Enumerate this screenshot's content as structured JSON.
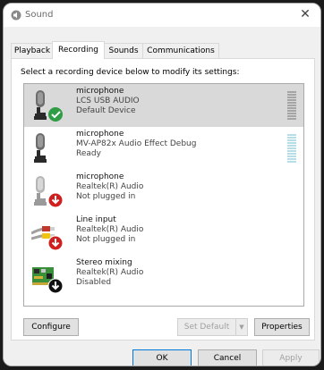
{
  "window": {
    "title": "Sound",
    "close_glyph": "✕"
  },
  "tabs": [
    {
      "label": "Playback",
      "active": false
    },
    {
      "label": "Recording",
      "active": true
    },
    {
      "label": "Sounds",
      "active": false
    },
    {
      "label": "Communications",
      "active": false
    }
  ],
  "instructions": "Select a recording device below to modify its settings:",
  "devices": [
    {
      "name": "microphone",
      "driver": "LCS USB AUDIO",
      "status": "Default Device",
      "icon": "microphone-icon",
      "badge": "green-check-badge",
      "selected": true
    },
    {
      "name": "microphone",
      "driver": "MV-AP82x Audio Effect Debug",
      "status": "Ready",
      "icon": "microphone-icon",
      "badge": "",
      "selected": false
    },
    {
      "name": "microphone",
      "driver": "Realtek(R) Audio",
      "status": "Not plugged in",
      "icon": "microphone-gray-icon",
      "badge": "red-down-arrow-badge",
      "selected": false
    },
    {
      "name": "Line input",
      "driver": "Realtek(R) Audio",
      "status": "Not plugged in",
      "icon": "line-input-cable-icon",
      "badge": "red-down-arrow-badge",
      "selected": false
    },
    {
      "name": "Stereo mixing",
      "driver": "Realtek(R) Audio",
      "status": "Disabled",
      "icon": "sound-card-icon",
      "badge": "black-down-arrow-badge",
      "selected": false
    }
  ],
  "buttons": {
    "configure": "Configure",
    "set_default": "Set Default",
    "set_default_arrow": "▼",
    "properties": "Properties",
    "ok": "OK",
    "cancel": "Cancel",
    "apply": "Apply"
  },
  "colors": {
    "meter_active": "#a5a5a5",
    "meter_ready": "#b7dde8",
    "check_badge": "#2e9d45",
    "down_badge": "#d11f1f"
  }
}
